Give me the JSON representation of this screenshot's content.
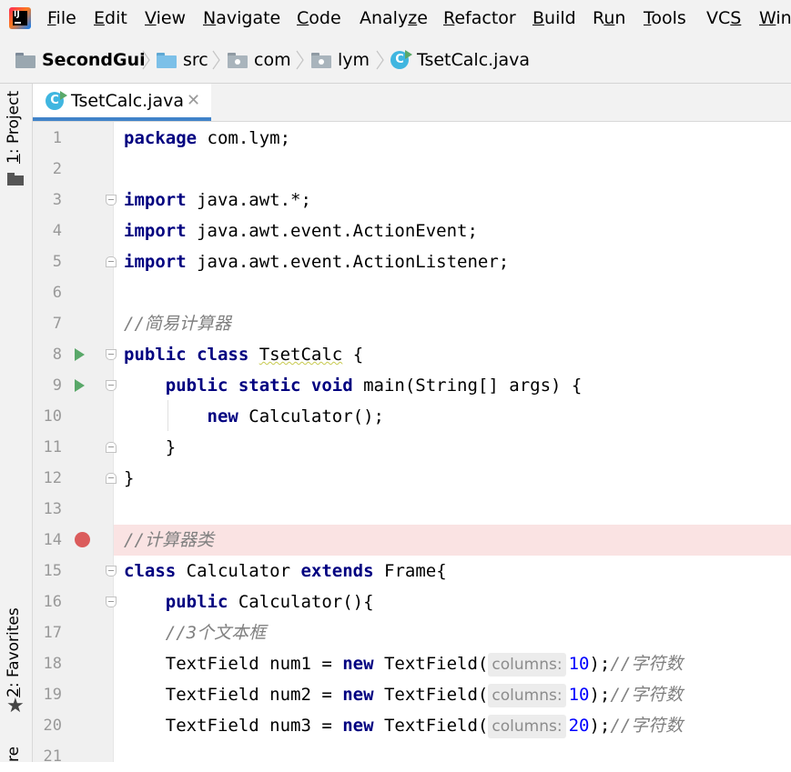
{
  "menu": [
    {
      "id": "file",
      "pre": "",
      "mn": "F",
      "post": "ile"
    },
    {
      "id": "edit",
      "pre": "",
      "mn": "E",
      "post": "dit"
    },
    {
      "id": "view",
      "pre": "",
      "mn": "V",
      "post": "iew"
    },
    {
      "id": "navigate",
      "pre": "",
      "mn": "N",
      "post": "avigate"
    },
    {
      "id": "code",
      "pre": "",
      "mn": "C",
      "post": "ode"
    },
    {
      "id": "analyze",
      "pre": "Analy",
      "mn": "z",
      "post": "e"
    },
    {
      "id": "refactor",
      "pre": "",
      "mn": "R",
      "post": "efactor"
    },
    {
      "id": "build",
      "pre": "",
      "mn": "B",
      "post": "uild"
    },
    {
      "id": "run",
      "pre": "R",
      "mn": "u",
      "post": "n"
    },
    {
      "id": "tools",
      "pre": "",
      "mn": "T",
      "post": "ools"
    },
    {
      "id": "vcs",
      "pre": "VC",
      "mn": "S",
      "post": ""
    },
    {
      "id": "window",
      "pre": "",
      "mn": "W",
      "post": "in"
    }
  ],
  "breadcrumb": [
    {
      "id": "project",
      "label": "SecondGui",
      "icon": "project-folder-icon"
    },
    {
      "id": "src",
      "label": "src",
      "icon": "source-folder-icon"
    },
    {
      "id": "com",
      "label": "com",
      "icon": "package-icon"
    },
    {
      "id": "lym",
      "label": "lym",
      "icon": "package-icon"
    },
    {
      "id": "file",
      "label": "TsetCalc.java",
      "icon": "java-class-icon"
    }
  ],
  "class_icon_letter": "C",
  "tool_windows": {
    "project": {
      "mn": "1",
      "rest": ": Project"
    },
    "favorites": {
      "mn": "2",
      "rest": ": Favorites"
    },
    "structure": {
      "label": "re"
    }
  },
  "editor_tab": {
    "label": "TsetCalc.java",
    "close": "✕"
  },
  "line_numbers": [
    "1",
    "2",
    "3",
    "4",
    "5",
    "6",
    "7",
    "8",
    "9",
    "10",
    "11",
    "12",
    "13",
    "14",
    "15",
    "16",
    "17",
    "18",
    "19",
    "20",
    "21"
  ],
  "code_lines": [
    [
      {
        "t": "kw",
        "v": "package"
      },
      {
        "t": "p",
        "v": " com.lym;"
      }
    ],
    [],
    [
      {
        "t": "kw",
        "v": "import"
      },
      {
        "t": "p",
        "v": " java.awt.*;"
      }
    ],
    [
      {
        "t": "kw",
        "v": "import"
      },
      {
        "t": "p",
        "v": " java.awt.event.ActionEvent;"
      }
    ],
    [
      {
        "t": "kw",
        "v": "import"
      },
      {
        "t": "p",
        "v": " java.awt.event.ActionListener;"
      }
    ],
    [],
    [
      {
        "t": "cmt",
        "v": "//简易计算器"
      }
    ],
    [
      {
        "t": "kw",
        "v": "public class"
      },
      {
        "t": "p",
        "v": " "
      },
      {
        "t": "warn",
        "v": "TsetCalc"
      },
      {
        "t": "p",
        "v": " {"
      }
    ],
    [
      {
        "t": "p",
        "v": "    "
      },
      {
        "t": "kw",
        "v": "public static void"
      },
      {
        "t": "p",
        "v": " main(String[] args) {"
      }
    ],
    [
      {
        "t": "p",
        "v": "        "
      },
      {
        "t": "kw",
        "v": "new"
      },
      {
        "t": "p",
        "v": " Calculator();"
      }
    ],
    [
      {
        "t": "p",
        "v": "    }"
      }
    ],
    [
      {
        "t": "p",
        "v": "}"
      }
    ],
    [],
    [
      {
        "t": "cmt",
        "v": "//计算器类"
      }
    ],
    [
      {
        "t": "kw",
        "v": "class"
      },
      {
        "t": "p",
        "v": " Calculator "
      },
      {
        "t": "kw",
        "v": "extends"
      },
      {
        "t": "p",
        "v": " Frame{"
      }
    ],
    [
      {
        "t": "p",
        "v": "    "
      },
      {
        "t": "kw",
        "v": "public"
      },
      {
        "t": "p",
        "v": " Calculator(){"
      }
    ],
    [
      {
        "t": "p",
        "v": "    "
      },
      {
        "t": "cmt",
        "v": "//3个文本框"
      }
    ],
    [
      {
        "t": "p",
        "v": "    TextField num1 = "
      },
      {
        "t": "kw",
        "v": "new"
      },
      {
        "t": "p",
        "v": " TextField("
      },
      {
        "t": "hint",
        "v": "columns:"
      },
      {
        "t": "num",
        "v": "10"
      },
      {
        "t": "p",
        "v": ");"
      },
      {
        "t": "cmt",
        "v": "//字符数"
      }
    ],
    [
      {
        "t": "p",
        "v": "    TextField num2 = "
      },
      {
        "t": "kw",
        "v": "new"
      },
      {
        "t": "p",
        "v": " TextField("
      },
      {
        "t": "hint",
        "v": "columns:"
      },
      {
        "t": "num",
        "v": "10"
      },
      {
        "t": "p",
        "v": ");"
      },
      {
        "t": "cmt",
        "v": "//字符数"
      }
    ],
    [
      {
        "t": "p",
        "v": "    TextField num3 = "
      },
      {
        "t": "kw",
        "v": "new"
      },
      {
        "t": "p",
        "v": " TextField("
      },
      {
        "t": "hint",
        "v": "columns:"
      },
      {
        "t": "num",
        "v": "20"
      },
      {
        "t": "p",
        "v": ");"
      },
      {
        "t": "cmt",
        "v": "//字符数"
      }
    ],
    []
  ],
  "highlighted_line": 14,
  "run_markers": [
    8,
    9
  ],
  "breakpoints": [
    14
  ],
  "fold_open": [
    3,
    8,
    9,
    15,
    16
  ],
  "fold_close": [
    5,
    11,
    12
  ],
  "colors": {
    "keyword": "#000080",
    "comment": "#808080",
    "number": "#0000ff",
    "breakpoint": "#db5c5c",
    "highlight_line": "#fae3e3",
    "run_marker": "#59a869",
    "tab_accent": "#4083c9"
  }
}
